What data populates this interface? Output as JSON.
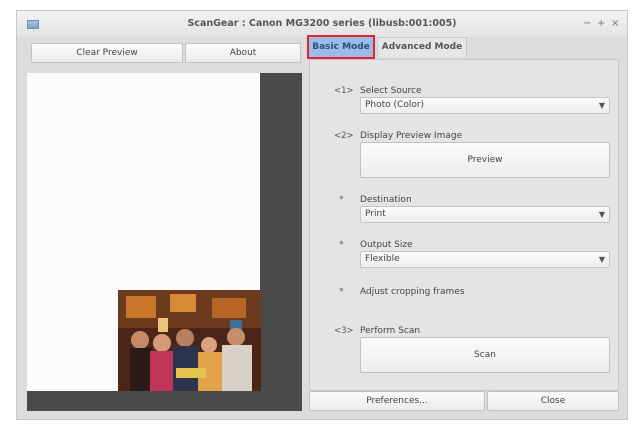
{
  "window": {
    "title": "ScanGear : Canon MG3200 series (libusb:001:005)",
    "minimize_label": "−",
    "maximize_label": "+",
    "close_label": "×"
  },
  "toolbar": {
    "clear_preview_label": "Clear Preview",
    "about_label": "About"
  },
  "tabs": [
    {
      "label": "Basic Mode",
      "selected": true
    },
    {
      "label": "Advanced Mode",
      "selected": false
    }
  ],
  "steps": {
    "select_source": {
      "num": "<1>",
      "label": "Select Source",
      "value": "Photo (Color)"
    },
    "display_preview": {
      "num": "<2>",
      "label": "Display Preview Image",
      "button": "Preview"
    },
    "destination": {
      "num": "*",
      "label": "Destination",
      "value": "Print"
    },
    "output_size": {
      "num": "*",
      "label": "Output Size",
      "value": "Flexible"
    },
    "adjust_cropping": {
      "num": "*",
      "label": "Adjust cropping frames"
    },
    "perform_scan": {
      "num": "<3>",
      "label": "Perform Scan",
      "button": "Scan"
    }
  },
  "footer": {
    "preferences_label": "Preferences...",
    "close_label": "Close"
  },
  "icons": {
    "dropdown": "▼"
  },
  "colors": {
    "tab_selected_bg": "#9cbbe6",
    "highlight_border": "#e32230"
  }
}
